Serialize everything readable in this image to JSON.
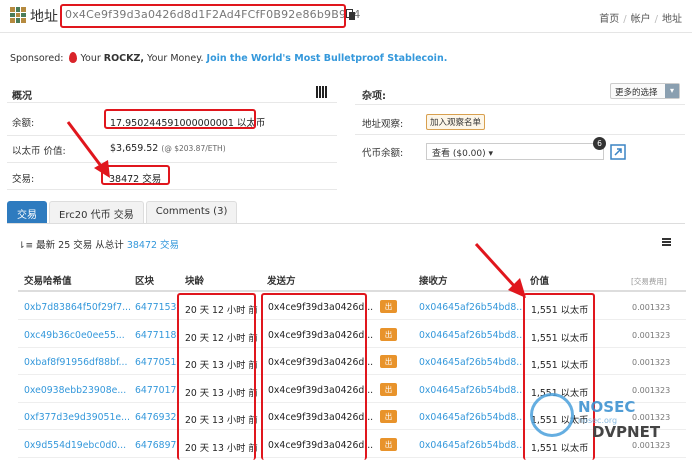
{
  "header": {
    "title": "地址",
    "address": "0x4Ce9f39d3a0426d8d1F2Ad4FCfF0B92e86b9B914",
    "nav": [
      "首页",
      "帐户",
      "地址"
    ]
  },
  "sponsored": {
    "label": "Sponsored:",
    "text1": "Your",
    "brand": "ROCKZ,",
    "text2": "Your Money.",
    "cta": "Join the World's Most Bulletproof Stablecoin."
  },
  "overview": {
    "title": "概况",
    "balance_label": "余额:",
    "balance_value": "17.950244591000000001 以太币",
    "eth_value_label": "以太币 价值:",
    "eth_value": "$3,659.52",
    "eth_price": "(@ $203.87/ETH)",
    "tx_label": "交易:",
    "tx_value": "38472 交易"
  },
  "misc": {
    "title": "杂项:",
    "more_button": "更多的选择",
    "watch_label": "地址观察:",
    "watch_button": "加入观察名单",
    "token_label": "代币余额:",
    "token_select": "查看 ($0.00) ▾",
    "token_count": "6"
  },
  "tabs": [
    {
      "label": "交易"
    },
    {
      "label": "Erc20 代币 交易"
    },
    {
      "label": "Comments (3)"
    }
  ],
  "summary": {
    "prefix": "最新 25 交易 从总计",
    "link": "38472 交易"
  },
  "table": {
    "columns": [
      "交易哈希值",
      "区块",
      "块龄",
      "发送方",
      "接收方",
      "价值",
      "[交易费用]"
    ],
    "rows": [
      {
        "hash": "0xb7d83864f50f29f7...",
        "block": "6477153",
        "age": "20 天 12 小时 前",
        "from": "0x4ce9f39d3a0426d...",
        "dir": "出",
        "to": "0x04645af26b54bd8...",
        "value": "1,551 以太币",
        "fee": "0.001323"
      },
      {
        "hash": "0xc49b36c0e0ee55...",
        "block": "6477118",
        "age": "20 天 12 小时 前",
        "from": "0x4ce9f39d3a0426d...",
        "dir": "出",
        "to": "0x04645af26b54bd8...",
        "value": "1,551 以太币",
        "fee": "0.001323"
      },
      {
        "hash": "0xbaf8f91956df88bf...",
        "block": "6477051",
        "age": "20 天 13 小时 前",
        "from": "0x4ce9f39d3a0426d...",
        "dir": "出",
        "to": "0x04645af26b54bd8...",
        "value": "1,551 以太币",
        "fee": "0.001323"
      },
      {
        "hash": "0xe0938ebb23908e...",
        "block": "6477017",
        "age": "20 天 13 小时 前",
        "from": "0x4ce9f39d3a0426d...",
        "dir": "出",
        "to": "0x04645af26b54bd8...",
        "value": "1,551 以太币",
        "fee": "0.001323"
      },
      {
        "hash": "0xf377d3e9d39051e...",
        "block": "6476932",
        "age": "20 天 13 小时 前",
        "from": "0x4ce9f39d3a0426d...",
        "dir": "出",
        "to": "0x04645af26b54bd8...",
        "value": "1,551 以太币",
        "fee": "0.001323"
      },
      {
        "hash": "0x9d554d19ebc0d0...",
        "block": "6476897",
        "age": "20 天 13 小时 前",
        "from": "0x4ce9f39d3a0426d...",
        "dir": "出",
        "to": "0x04645af26b54bd8...",
        "value": "1,551 以太币",
        "fee": "0.001323"
      }
    ]
  },
  "watermark": {
    "brand": "NOSEC",
    "site": "nosec.org",
    "partner": "DVPNET"
  },
  "colors": {
    "highlight": "#e0161d",
    "link": "#3498db",
    "tab_active": "#2e7bbf",
    "out_badge": "#e8932b"
  }
}
